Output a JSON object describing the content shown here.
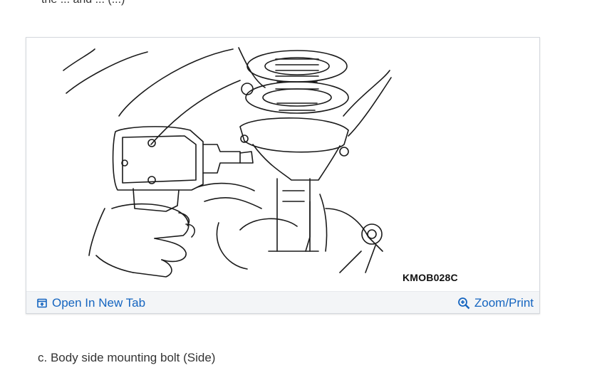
{
  "page": {
    "clipped_text": "the ... and ... (...)",
    "caption": "c. Body side mounting bolt (Side)"
  },
  "figure": {
    "code": "KMOB028C",
    "image_subject": "illustration of an impact wrench removing a strut body side mounting bolt"
  },
  "toolbar": {
    "open_label": "Open In New Tab",
    "open_icon": "open-new-tab-icon",
    "zoom_label": "Zoom/Print",
    "zoom_icon": "zoom-magnifier-icon",
    "link_color": "#1565c0",
    "bar_color": "#f3f5f7"
  }
}
